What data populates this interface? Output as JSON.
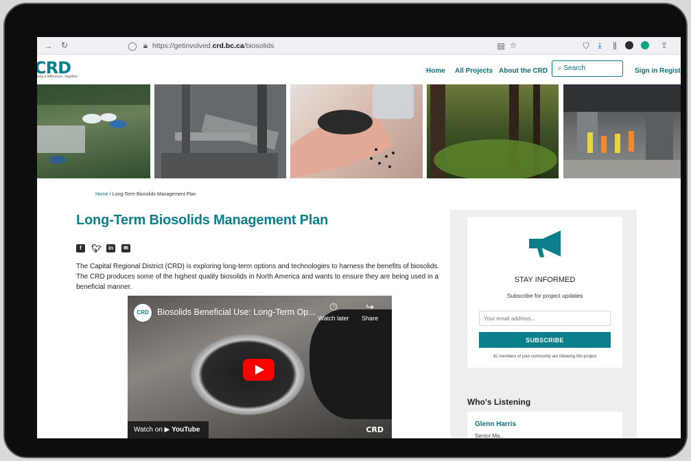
{
  "browser": {
    "url_prefix": "https://getinvolved.",
    "url_domain": "crd.bc.ca",
    "url_path": "/biosolids"
  },
  "header": {
    "logo_text": "CRD",
    "logo_tagline": "king a difference...together",
    "nav": {
      "home": "Home",
      "all_projects": "All Projects",
      "about": "About the CRD",
      "search_placeholder": "Search",
      "sign_in": "Sign in",
      "register": "Regist"
    }
  },
  "breadcrumb": {
    "home": "Home",
    "separator": "/",
    "current": "Long-Term Biosolids Management Plan"
  },
  "main": {
    "title": "Long-Term Biosolids Management Plan",
    "social": [
      "facebook-icon",
      "twitter-icon",
      "linkedin-icon",
      "email-icon"
    ],
    "intro": "The Capital Regional District (CRD) is exploring long-term options and technologies to harness the benefits of biosolids. The CRD produces some of the highest quality biosolids in North America and wants to ensure they are being used in a beneficial manner."
  },
  "video": {
    "channel_logo": "CRD",
    "title": "Biosolids Beneficial Use: Long-Term Op...",
    "watch_later": "Watch later",
    "share": "Share",
    "watch_on": "Watch on",
    "youtube": "YouTube",
    "watermark": "CRD"
  },
  "sidebar": {
    "stay_title": "STAY INFORMED",
    "stay_sub": "Subscribe for project updates",
    "email_placeholder": "Your email address...",
    "subscribe": "SUBSCRIBE",
    "followers": "81 members of your community are following this project",
    "listening_title": "Who's Listening",
    "person_name": "Glenn Harris",
    "person_role": "Senior Ma..."
  },
  "colors": {
    "accent": "#0b7f8c",
    "link": "#0b6e7a",
    "youtube_red": "#ff0000"
  }
}
